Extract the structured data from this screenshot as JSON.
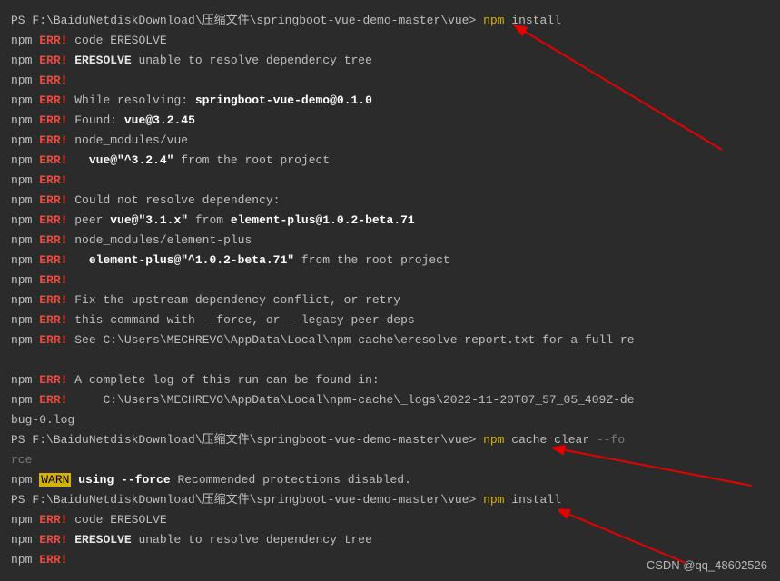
{
  "prompt_path": "PS F:\\BaiduNetdiskDownload\\压缩文件\\springboot-vue-demo-master\\vue> ",
  "cmd_npm": "npm",
  "cmd_install": "install",
  "cmd_cache": "cache",
  "cmd_clear": "clear",
  "flag_force": " --fo",
  "flag_force_wrap": "rce",
  "npm": "npm ",
  "err": "ERR!",
  "warn": "WARN",
  "code_eresolve": " code ERESOLVE",
  "eresolve_tag": " ERESOLVE",
  "unable_resolve": " unable to resolve dependency tree",
  "while_resolving": " While resolving: ",
  "pkg_main": "springboot-vue-demo@0.1.0",
  "found": " Found: ",
  "vue_found": "vue@3.2.45",
  "nm_vue": " node_modules/vue",
  "vue_root_pre": "   ",
  "vue_spec": "vue@\"^3.2.4\"",
  "from_root": " from the root project",
  "could_not": " Could not resolve dependency:",
  "peer_pre": " peer ",
  "peer_vue": "vue@\"3.1.x\"",
  "from_el": " from ",
  "el_plus": "element-plus@1.0.2-beta.71",
  "nm_el": " node_modules/element-plus",
  "el_spec_pre": "   ",
  "el_spec": "element-plus@\"^1.0.2-beta.71\"",
  "fix_upstream": " Fix the upstream dependency conflict, or retry",
  "this_cmd": " this command with --force, or --legacy-peer-deps",
  "see_report": " See C:\\Users\\MECHREVO\\AppData\\Local\\npm-cache\\eresolve-report.txt for a full re",
  "complete_log": " A complete log of this run can be found in:",
  "log_path": "     C:\\Users\\MECHREVO\\AppData\\Local\\npm-cache\\_logs\\2022-11-20T07_57_05_409Z-de",
  "log_wrap": "bug-0.log",
  "warn_using": " using ",
  "warn_force": "--force",
  "warn_rec": " Recommended protections disabled.",
  "blank": " ",
  "watermark": "CSDN @qq_48602526"
}
